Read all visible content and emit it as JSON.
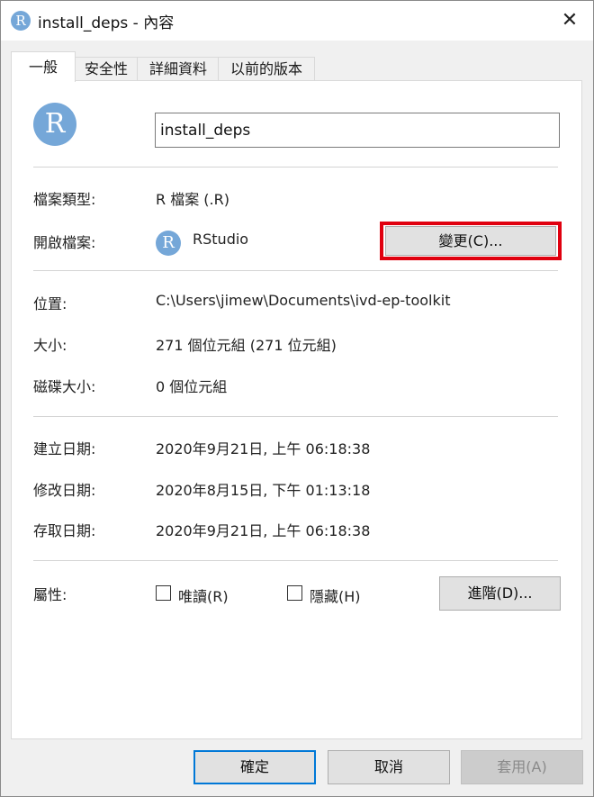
{
  "window": {
    "title": "install_deps - 內容",
    "app_icon_letter": "R",
    "close_glyph": "✕"
  },
  "tabs": [
    {
      "label": "一般",
      "active": true
    },
    {
      "label": "安全性"
    },
    {
      "label": "詳細資料"
    },
    {
      "label": "以前的版本"
    }
  ],
  "general": {
    "file_name": "install_deps",
    "file_type_label": "檔案類型:",
    "file_type_value": "R 檔案 (.R)",
    "opens_with_label": "開啟檔案:",
    "opens_with_app": "RStudio",
    "change_button": "變更(C)...",
    "location_label": "位置:",
    "location_value": "C:\\Users\\jimew\\Documents\\ivd-ep-toolkit",
    "size_label": "大小:",
    "size_value": "271 個位元組 (271 位元組)",
    "disk_size_label": "磁碟大小:",
    "disk_size_value": "0 個位元組",
    "created_label": "建立日期:",
    "created_value": "2020年9月21日, 上午 06:18:38",
    "modified_label": "修改日期:",
    "modified_value": "2020年8月15日, 下午 01:13:18",
    "accessed_label": "存取日期:",
    "accessed_value": "2020年9月21日, 上午 06:18:38",
    "attributes_label": "屬性:",
    "readonly_label": "唯讀(R)",
    "readonly_checked": false,
    "hidden_label": "隱藏(H)",
    "hidden_checked": false,
    "advanced_button": "進階(D)..."
  },
  "footer": {
    "ok": "確定",
    "cancel": "取消",
    "apply": "套用(A)"
  },
  "colors": {
    "highlight": "#e0000f",
    "icon_blue": "#75a7d8",
    "ok_border": "#0078d7"
  }
}
